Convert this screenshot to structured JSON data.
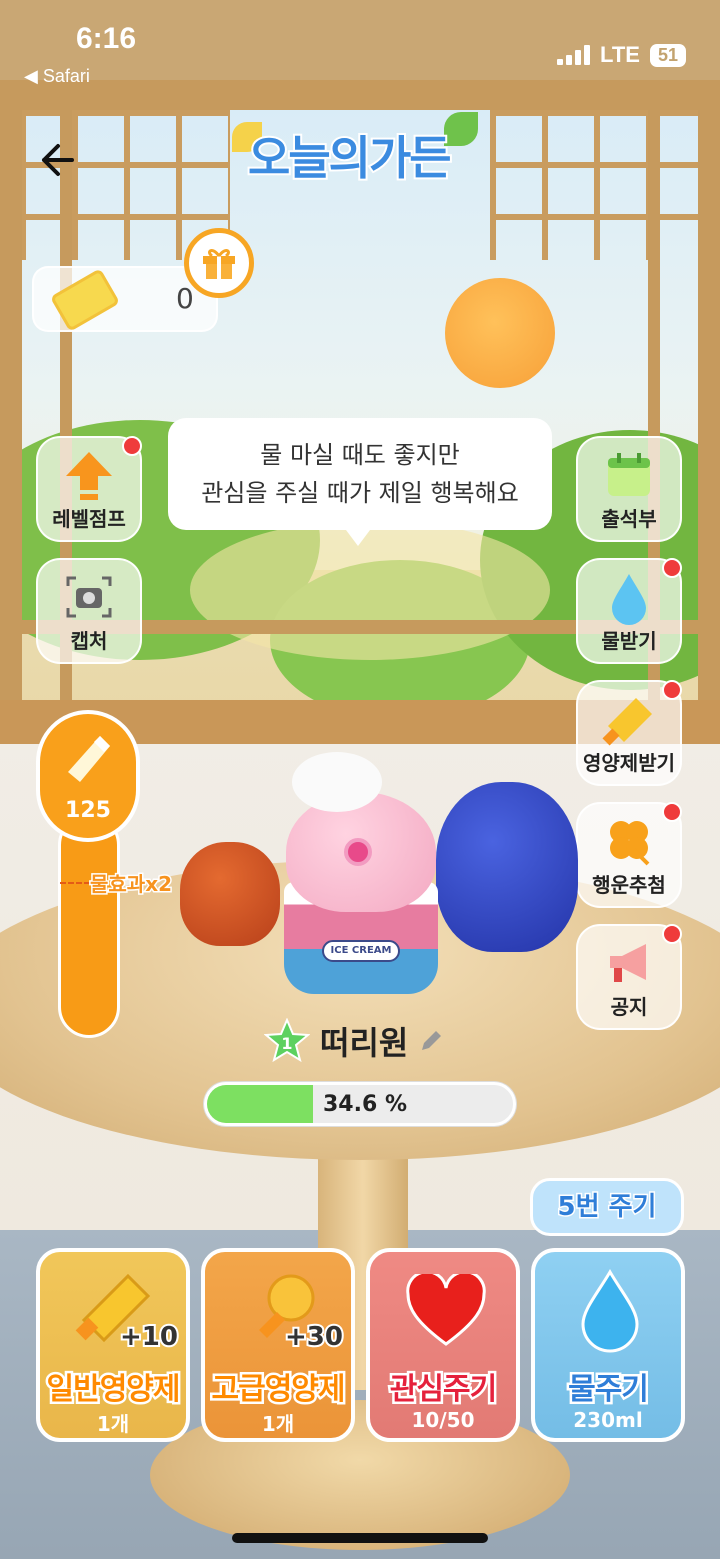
{
  "status_bar": {
    "time": "6:16",
    "back_app": "◀ Safari",
    "network": "LTE",
    "battery": "51"
  },
  "header": {
    "logo_text": "오늘의가든"
  },
  "ticket": {
    "count": "0"
  },
  "speech_bubble": {
    "line1": "물 마실 때도 좋지만",
    "line2": "관심을 주실 때가 제일 행복해요"
  },
  "left_menu": [
    {
      "label": "레벨점프",
      "badge": true
    },
    {
      "label": "캡처",
      "badge": false
    }
  ],
  "right_menu": [
    {
      "label": "출석부",
      "badge": false
    },
    {
      "label": "물받기",
      "badge": true
    },
    {
      "label": "영양제받기",
      "badge": true
    },
    {
      "label": "행운추첨",
      "badge": true
    },
    {
      "label": "공지",
      "badge": true
    }
  ],
  "gauge": {
    "value": "125",
    "water_bonus": "물효과x2"
  },
  "character": {
    "level": "1",
    "name": "떠리원",
    "progress_text": "34.6 %",
    "progress": 0.346,
    "cup_text": "ICE CREAM"
  },
  "water_tag": "5번 주기",
  "actions": [
    {
      "label": "일반영양제",
      "plus": "+10",
      "count": "1개"
    },
    {
      "label": "고급영양제",
      "plus": "+30",
      "count": "1개"
    },
    {
      "label": "관심주기",
      "count": "10/50"
    },
    {
      "label": "물주기",
      "count": "230ml"
    }
  ],
  "colors": {
    "accent_orange": "#f89b16",
    "progress_green": "#7de061",
    "badge_red": "#ef3b3b",
    "water_blue": "#2f7ed8"
  }
}
